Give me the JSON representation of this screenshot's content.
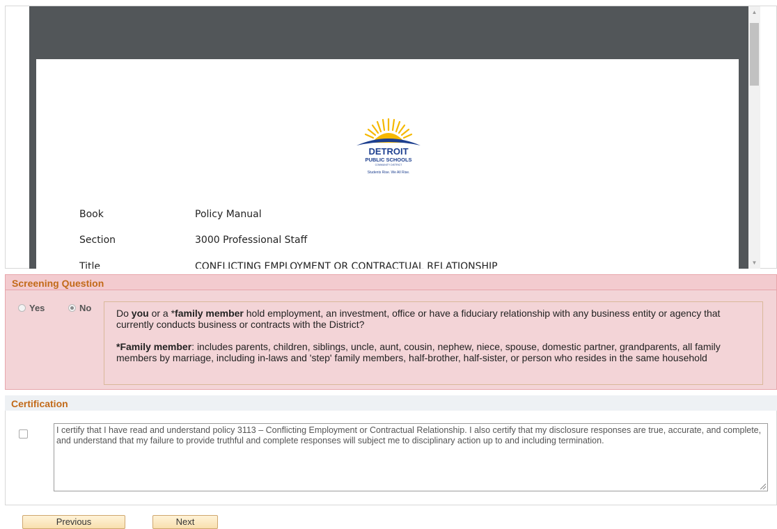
{
  "document": {
    "logo": {
      "name": "DETROIT",
      "line2": "PUBLIC SCHOOLS",
      "line3": "COMMUNITY DISTRICT",
      "tagline": "Students Rise. We All Rise."
    },
    "rows": [
      {
        "key": "Book",
        "value": "Policy Manual"
      },
      {
        "key": "Section",
        "value": "3000 Professional Staff"
      },
      {
        "key": "Title",
        "value": "CONFLICTING EMPLOYMENT OR CONTRACTUAL RELATIONSHIP"
      }
    ]
  },
  "screening": {
    "heading": "Screening Question",
    "options": {
      "yes": "Yes",
      "no": "No",
      "selected": "No"
    },
    "question": {
      "p1_pre": "Do ",
      "p1_bold1": "you",
      "p1_mid": " or a *",
      "p1_bold2": "family member",
      "p1_post": " hold employment, an investment, office or have a fiduciary relationship with any business entity or agency that currently conducts business or contracts with the District?",
      "p2_bold": "*Family member",
      "p2_post": ": includes parents, children, siblings, uncle, aunt, cousin, nephew, niece, spouse, domestic partner, grandparents, all family members by marriage, including in-laws and 'step' family members, half-brother, half-sister, or person who resides in the same household"
    }
  },
  "certification": {
    "heading": "Certification",
    "checked": false,
    "text": "I certify that I have read and understand policy 3113 – Conflicting Employment or Contractual Relationship. I also certify that my disclosure responses are true, accurate, and complete, and understand that my failure to provide truthful and complete responses will subject me to disciplinary action up to and including termination."
  },
  "buttons": {
    "previous": "Previous",
    "next": "Next"
  },
  "colors": {
    "section_title": "#c26a19",
    "screening_bg": "#f3d4d7",
    "button_bg": "#f8dfae",
    "viewer_bg": "#525659"
  }
}
